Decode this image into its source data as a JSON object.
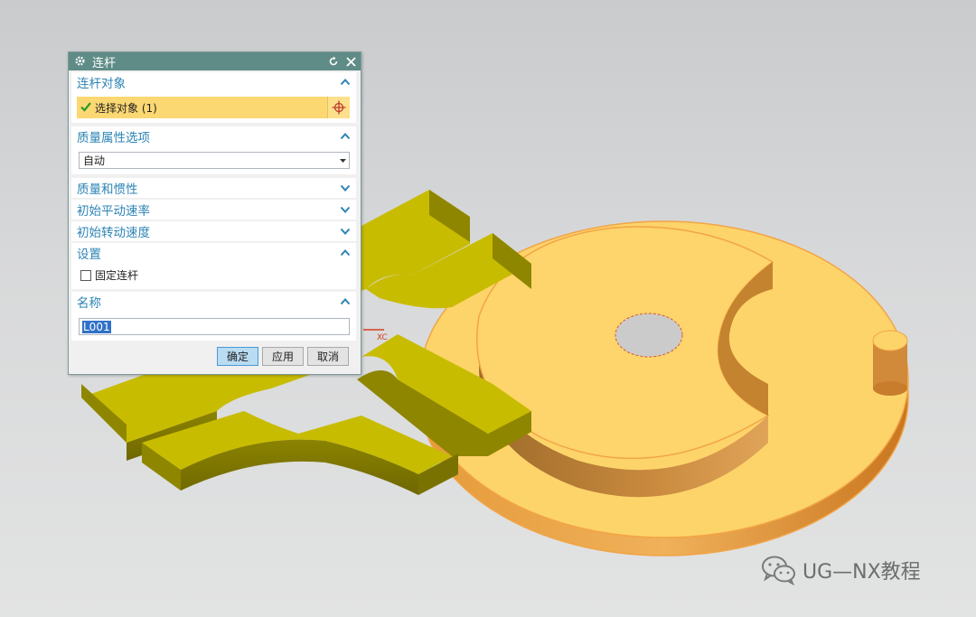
{
  "dialog": {
    "title": "连杆",
    "sections": {
      "link_object": {
        "header": "连杆对象",
        "select_label": "选择对象 (1)"
      },
      "mass_props": {
        "header": "质量属性选项",
        "selected": "自动"
      },
      "mass_inertia": {
        "header": "质量和惯性"
      },
      "init_translational": {
        "header": "初始平动速率"
      },
      "init_rotational": {
        "header": "初始转动速度"
      },
      "settings": {
        "header": "设置",
        "fix_link_label": "固定连杆",
        "fix_link_checked": false
      },
      "name": {
        "header": "名称",
        "value": "L001"
      }
    },
    "buttons": {
      "ok": "确定",
      "apply": "应用",
      "cancel": "取消"
    }
  },
  "viewport": {
    "axis_label": "XC"
  },
  "watermark": {
    "text": "UG—NX教程"
  },
  "colors": {
    "title_bar": "#5f8c87",
    "section_header": "#2d84b4",
    "selection_highlight": "#fcd873",
    "part_yellow": "#c8bc00",
    "disk_orange": "#fdd46a"
  }
}
